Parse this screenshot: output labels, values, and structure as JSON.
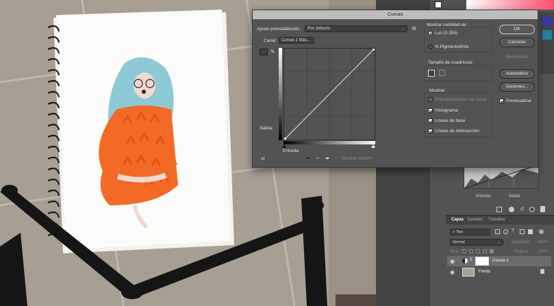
{
  "dialog": {
    "title": "Curvas",
    "preset_label": "Ajuste preestablecido:",
    "preset_value": "Por defecto",
    "channel_label": "Canal:",
    "channel_value": "Curvas 1 Más...",
    "output_label": "Salida:",
    "input_label": "Entrada:",
    "show_clipping": "Mostrar recorte",
    "show_amount": {
      "title": "Mostrar cantidad de:",
      "options": [
        {
          "label": "Luz (0-255)",
          "selected": true
        },
        {
          "label": "% Pigmento/tinta",
          "selected": false
        }
      ]
    },
    "grid_size_title": "Tamaño de cuadrícula:",
    "show": {
      "title": "Mostrar:",
      "options": [
        {
          "label": "Superposiciones de canal",
          "checked": false,
          "disabled": true
        },
        {
          "label": "Histograma",
          "checked": true
        },
        {
          "label": "Líneas de base",
          "checked": true
        },
        {
          "label": "Líneas de intersección",
          "checked": true
        }
      ]
    },
    "buttons": {
      "ok": "OK",
      "cancel": "Cancelar",
      "smooth": "Redondear",
      "auto": "Automático",
      "options": "Opciones..."
    },
    "preview_label": "Previsualizar"
  },
  "right_panel": {
    "mini_input_label": "Entrada",
    "mini_output_label": "Salida",
    "tabs": [
      "Capas",
      "Canales",
      "Trazados"
    ],
    "kind_filter": "Tipo",
    "blend_mode": "Normal",
    "opacity_label": "Opacidad:",
    "opacity_value": "100%",
    "lock_label": "Bloq.:",
    "fill_label": "Relleno:",
    "fill_value": "100%",
    "layers": [
      {
        "name": "Curvas 1"
      },
      {
        "name": "Fondo"
      }
    ]
  },
  "colors": {
    "panel": "#535353",
    "dialog": "#535353",
    "accent_curve": "#ffffff"
  }
}
